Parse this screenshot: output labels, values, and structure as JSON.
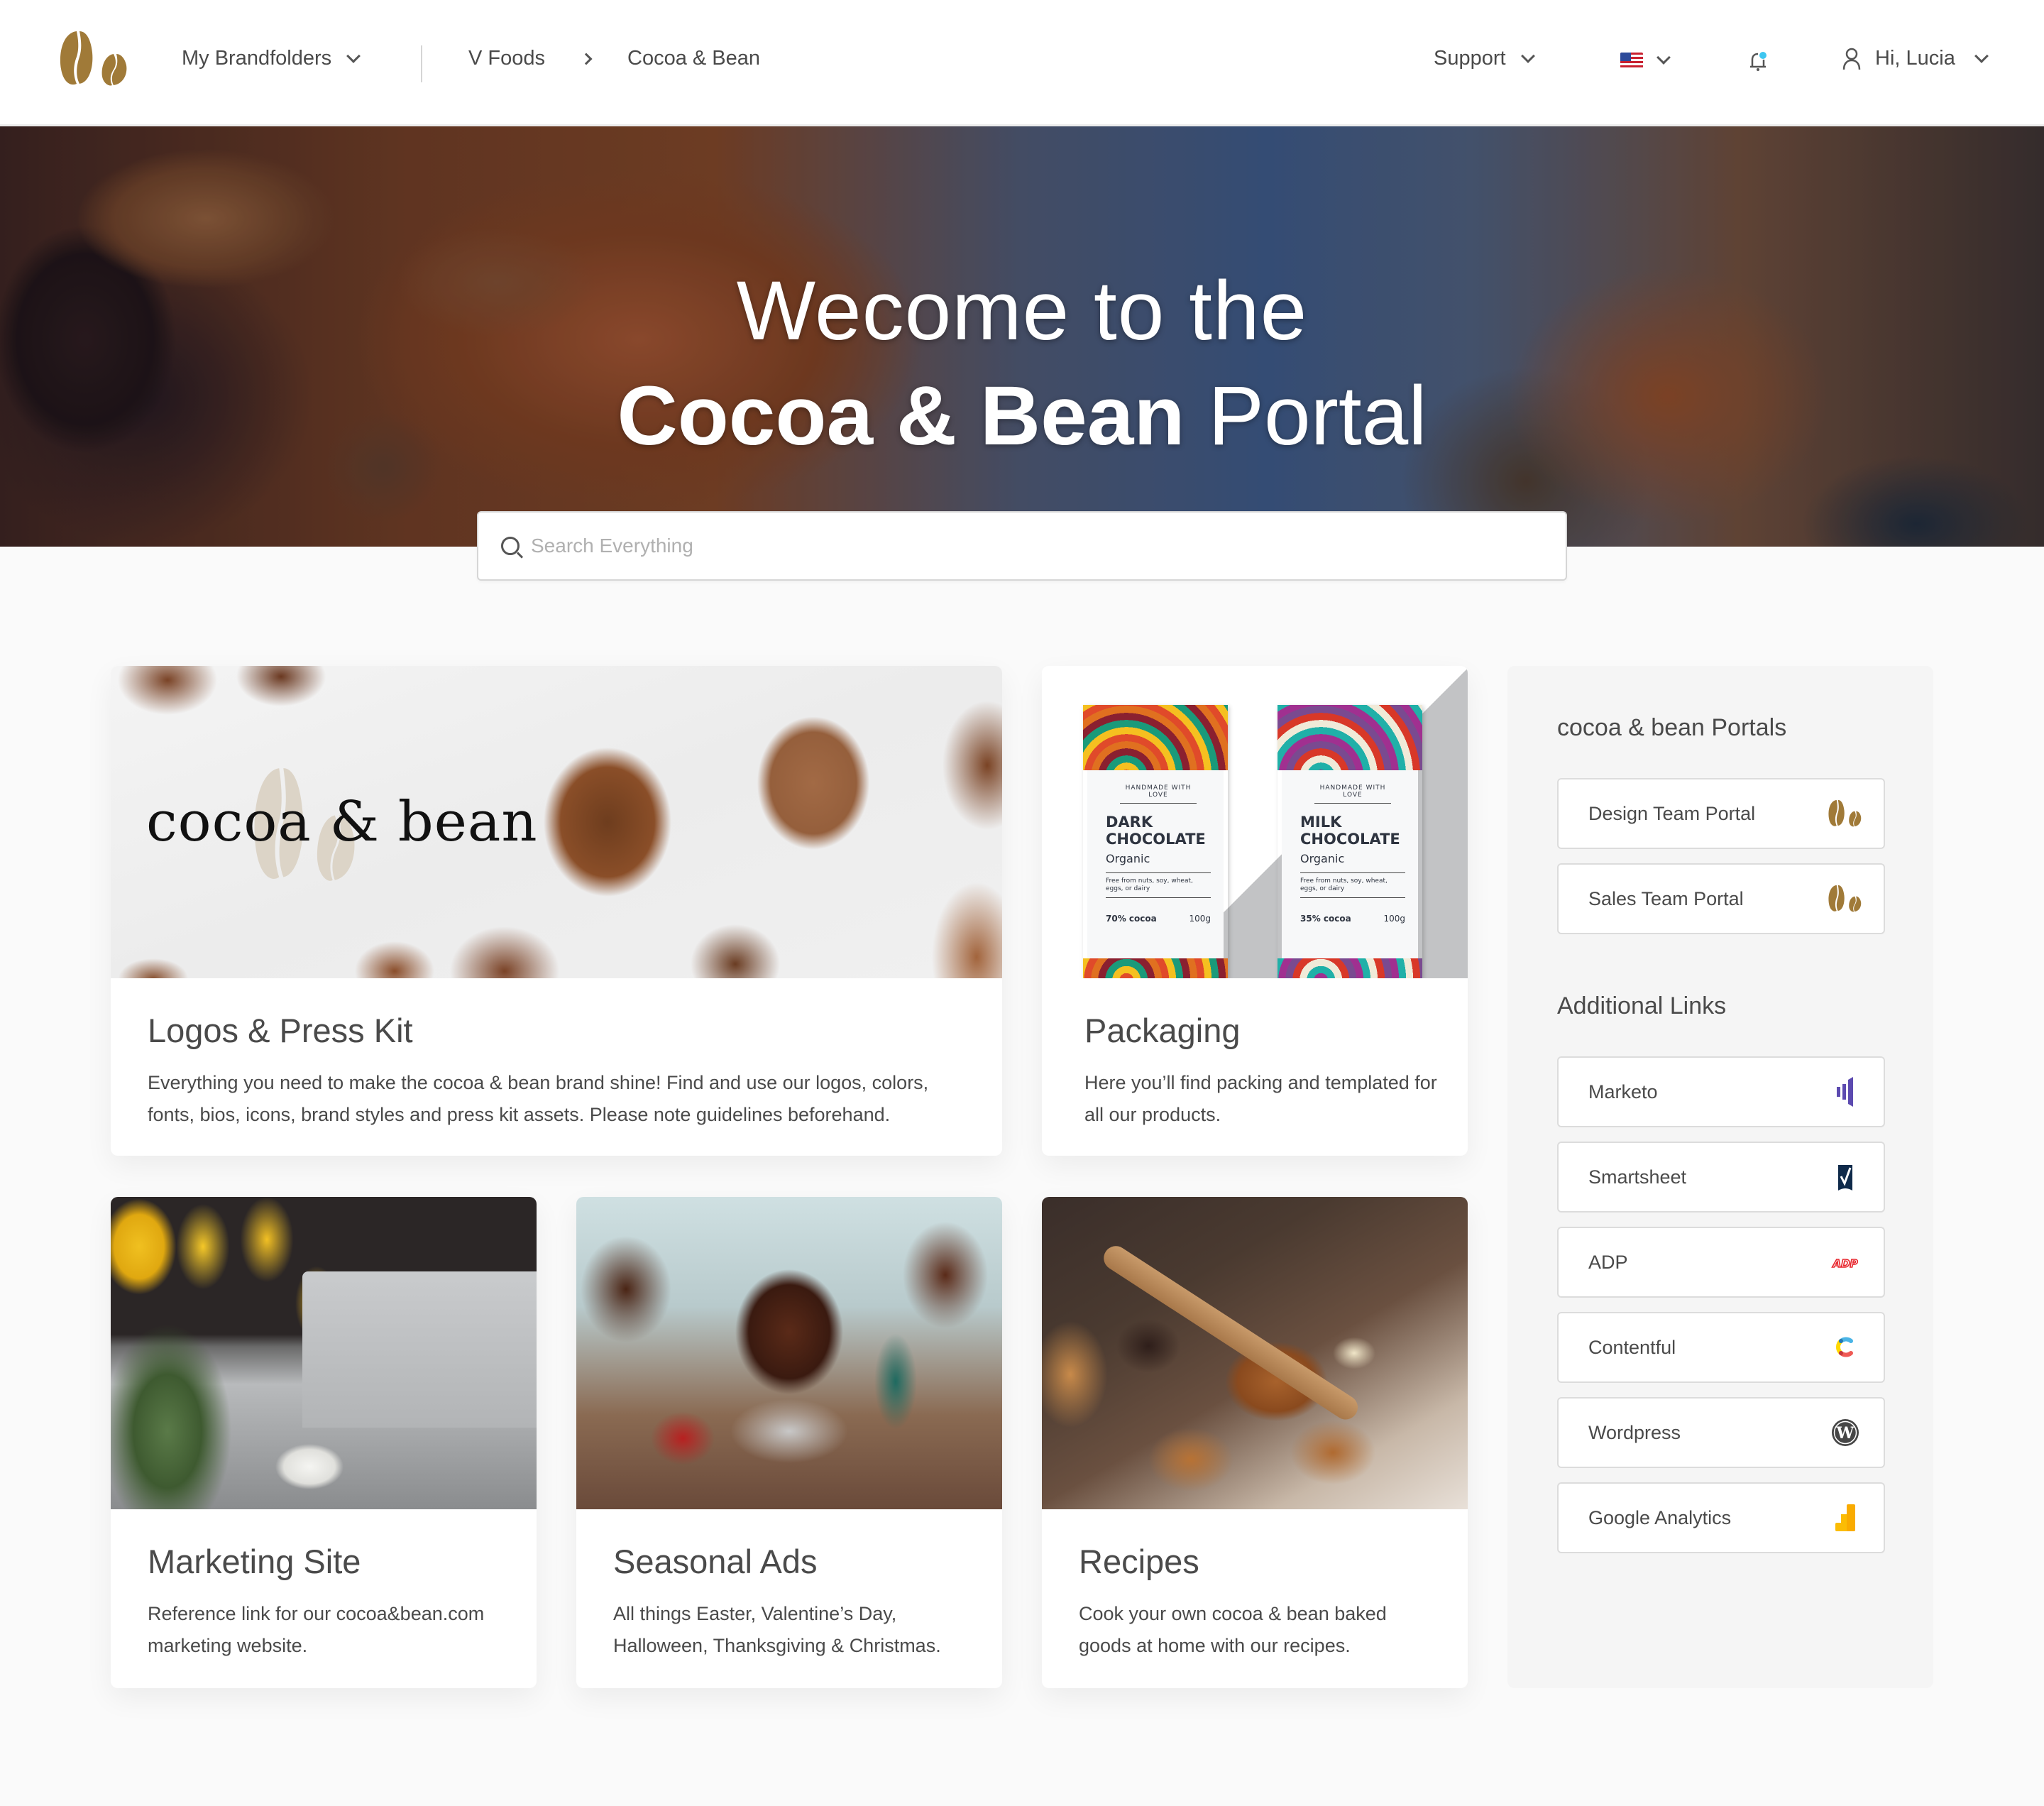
{
  "header": {
    "brand_logo": "coffee-bean-logo",
    "brand_color": "#a07a38",
    "my_brandfolders_label": "My Brandfolders",
    "breadcrumb": [
      "V Foods",
      "Cocoa & Bean"
    ],
    "support_label": "Support",
    "language_flag": "us-flag",
    "notification_dot_color": "#3ec6f0",
    "greeting": "Hi, Lucia"
  },
  "hero": {
    "line1": "Wecome to the",
    "line2_bold": "Cocoa & Bean",
    "line2_regular": " Portal"
  },
  "search": {
    "placeholder": "Search Everything",
    "value": ""
  },
  "cards": [
    {
      "id": "logos",
      "title": "Logos & Press Kit",
      "description": "Everything you need to make the cocoa & bean brand shine! Find and use our logos, colors, fonts, bios, icons, brand styles and press kit assets. Please note guidelines beforehand.",
      "image_wordmark": "cocoa & bean"
    },
    {
      "id": "packaging",
      "title": "Packaging",
      "description": "Here you’ll find packing and templated for all our products.",
      "products": [
        {
          "tagline": "HANDMADE WITH LOVE",
          "name": "DARK CHOCOLATE",
          "variant": "Organic",
          "allergens": "Free from nuts, soy, wheat, eggs, or dairy",
          "cocoa": "70% cocoa",
          "weight": "100g"
        },
        {
          "tagline": "HANDMADE WITH LOVE",
          "name": "MILK CHOCOLATE",
          "variant": "Organic",
          "allergens": "Free from nuts, soy, wheat, eggs, or dairy",
          "cocoa": "35% cocoa",
          "weight": "100g"
        }
      ]
    },
    {
      "id": "marketing",
      "title": "Marketing Site",
      "description": "Reference link for our cocoa&bean.com marketing website."
    },
    {
      "id": "seasonal",
      "title": "Seasonal Ads",
      "description": "All things Easter, Valentine’s Day, Halloween, Thanksgiving & Christmas."
    },
    {
      "id": "recipes",
      "title": "Recipes",
      "description": "Cook your own cocoa & bean baked goods at home with our recipes."
    }
  ],
  "sidebar": {
    "portals_heading": "cocoa & bean Portals",
    "portals": [
      {
        "label": "Design Team Portal",
        "icon": "coffee-bean-icon"
      },
      {
        "label": "Sales Team Portal",
        "icon": "coffee-bean-icon"
      }
    ],
    "links_heading": "Additional Links",
    "links": [
      {
        "label": "Marketo",
        "icon": "marketo-icon",
        "color": "#5c4ab0"
      },
      {
        "label": "Smartsheet",
        "icon": "smartsheet-icon",
        "color": "#0f2a4a"
      },
      {
        "label": "ADP",
        "icon": "adp-icon",
        "color": "#e8262d"
      },
      {
        "label": "Contentful",
        "icon": "contentful-icon",
        "color": "#4ab4e6"
      },
      {
        "label": "Wordpress",
        "icon": "wordpress-icon",
        "color": "#464646"
      },
      {
        "label": "Google Analytics",
        "icon": "google-analytics-icon",
        "color": "#f9ab00"
      }
    ]
  }
}
